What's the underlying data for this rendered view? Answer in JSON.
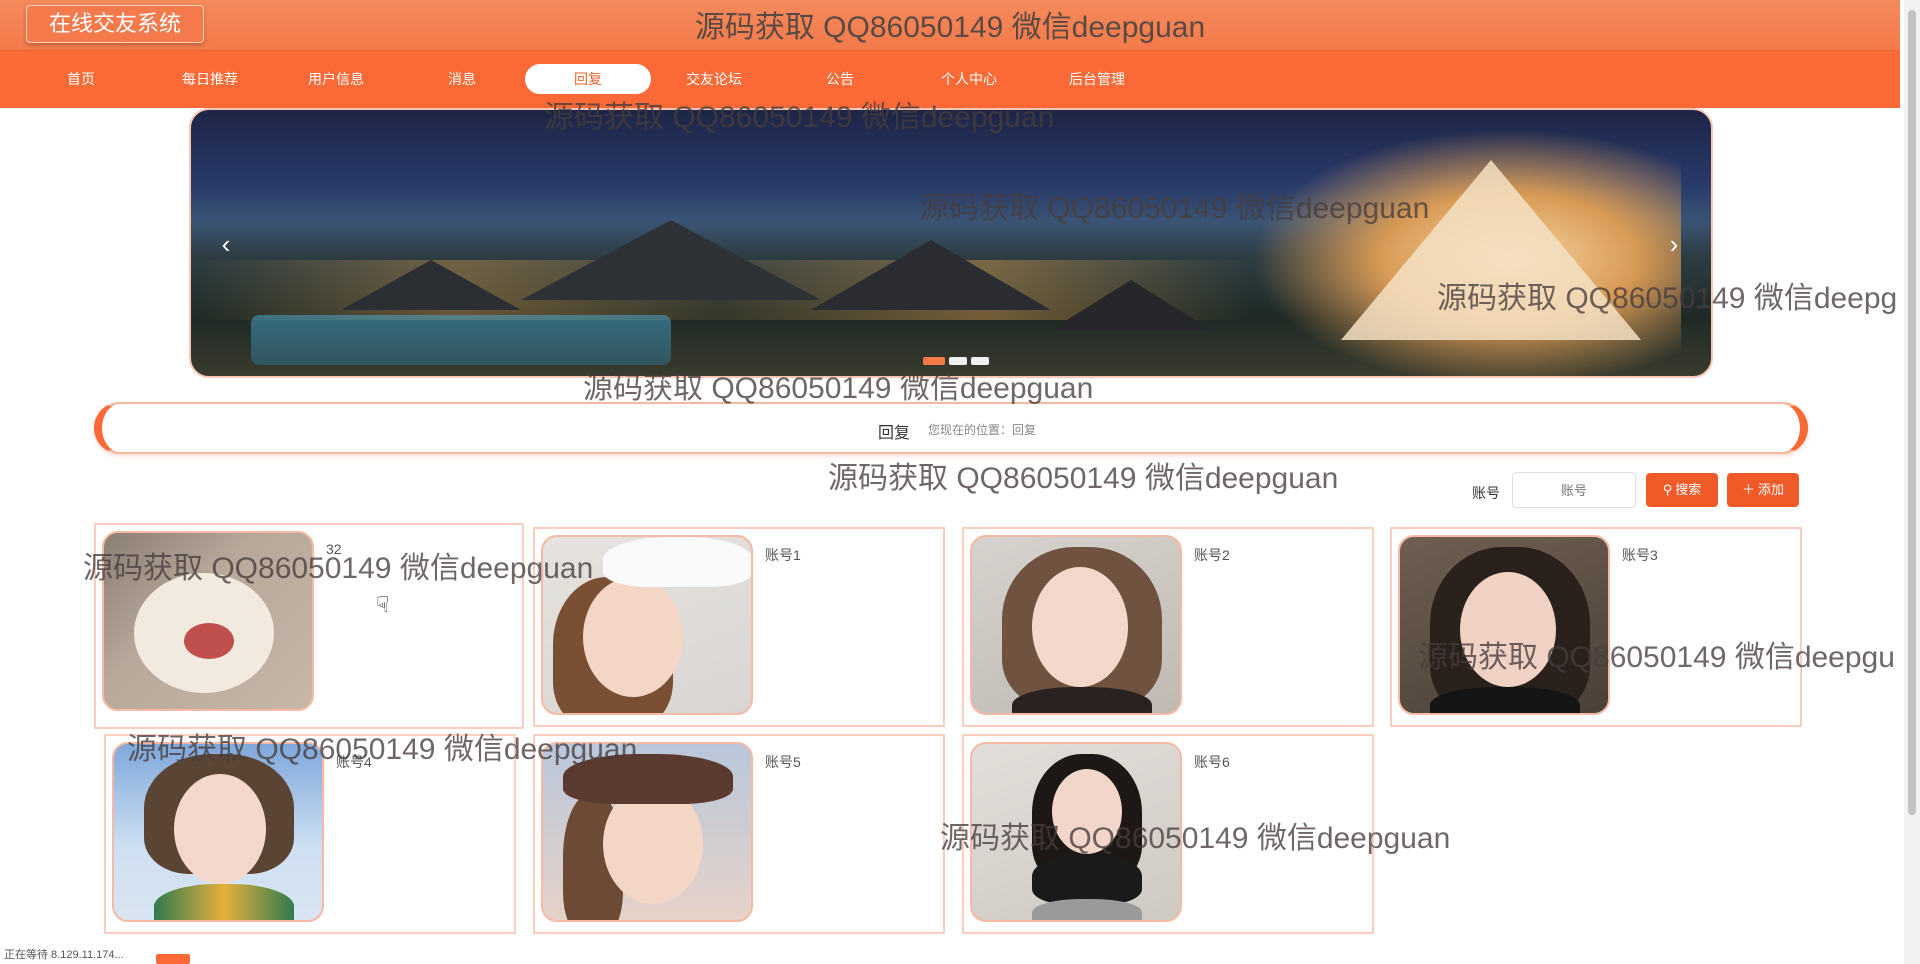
{
  "brand": "在线交友系统",
  "top_watermark": "源码获取 QQ86050149 微信deepguan",
  "nav": [
    {
      "label": "首页"
    },
    {
      "label": "每日推荐"
    },
    {
      "label": "用户信息"
    },
    {
      "label": "消息"
    },
    {
      "label": "回复",
      "active": true
    },
    {
      "label": "交友论坛"
    },
    {
      "label": "公告"
    },
    {
      "label": "个人中心"
    },
    {
      "label": "后台管理"
    }
  ],
  "carousel": {
    "prev_icon": "chevron-left-icon",
    "next_icon": "chevron-right-icon",
    "slides": 3,
    "active": 0
  },
  "breadcrumb": {
    "title": "回复",
    "location": "您现在的位置：回复"
  },
  "search": {
    "label": "账号",
    "placeholder": "账号",
    "search_button": "搜索",
    "add_button": "添加"
  },
  "cards": [
    {
      "name": "32",
      "photo": "cat-yawning"
    },
    {
      "name": "账号1",
      "photo": "girl-with-cap-and-glasses"
    },
    {
      "name": "账号2",
      "photo": "girl-short-hair-choker"
    },
    {
      "name": "账号3",
      "photo": "girl-dark-shirt-rocks"
    },
    {
      "name": "账号4",
      "photo": "girl-floral-swimsuit"
    },
    {
      "name": "账号5",
      "photo": "girl-cap-braids"
    },
    {
      "name": "账号6",
      "photo": "girl-peace-sign"
    }
  ],
  "watermarks": [
    "源码获取 QQ86050149 微信deepguan",
    "源码获取 QQ86050149 微信deepguan",
    "源码获取 QQ86050149 微信deepg",
    "源码获取 QQ86050149 微信deepguan",
    "源码获取 QQ86050149 微信deepguan",
    "源码获取 QQ86050149 微信deepguan",
    "源码获取 QQ86050149 微信deepgu",
    "源码获取 QQ86050149 微信deepguan",
    "源码获取 QQ86050149 微信deepguan"
  ],
  "status_text": "正在等待 8.129.11.174...",
  "colors": {
    "accent": "#fb6a36",
    "button": "#f05a28",
    "card_border": "#fbcfc0"
  }
}
